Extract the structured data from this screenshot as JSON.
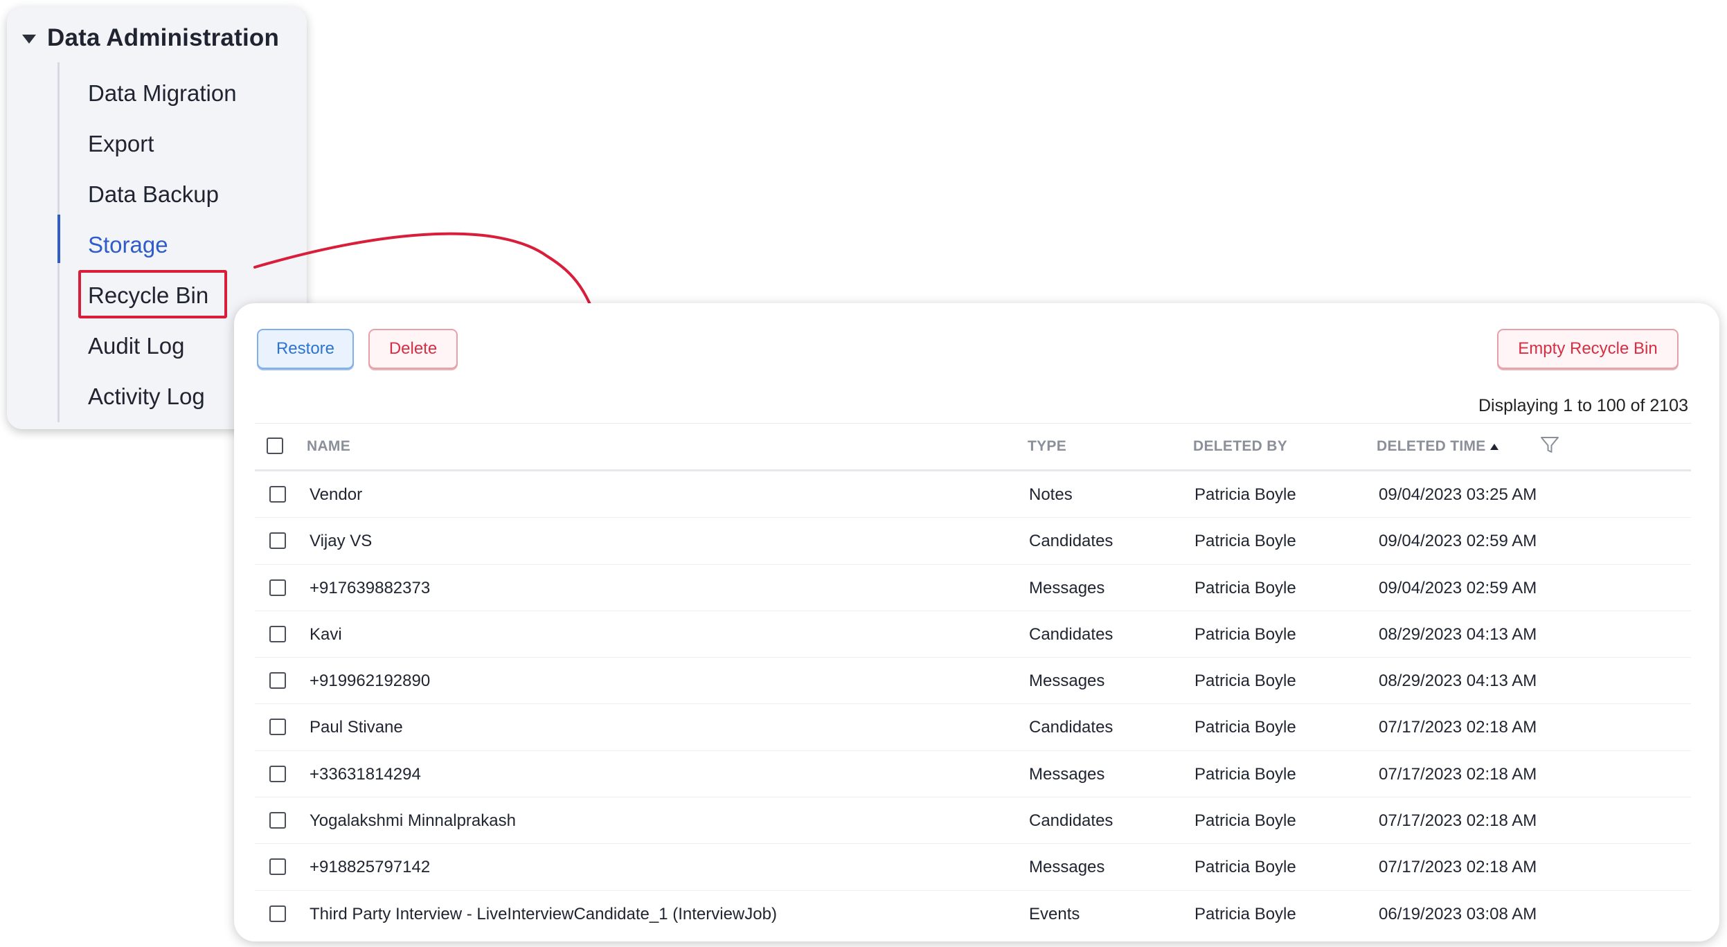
{
  "sidebar": {
    "section_title": "Data Administration",
    "items": [
      {
        "label": "Data Migration"
      },
      {
        "label": "Export"
      },
      {
        "label": "Data Backup"
      },
      {
        "label": "Storage"
      },
      {
        "label": "Recycle Bin"
      },
      {
        "label": "Audit Log"
      },
      {
        "label": "Activity Log"
      }
    ],
    "active_item": "Storage",
    "highlighted_item": "Recycle Bin"
  },
  "toolbar": {
    "restore_label": "Restore",
    "delete_label": "Delete",
    "empty_label": "Empty Recycle Bin"
  },
  "pagination": {
    "text": "Displaying 1 to 100 of 2103"
  },
  "table": {
    "columns": {
      "name": "NAME",
      "type": "TYPE",
      "deleted_by": "DELETED BY",
      "deleted_time": "DELETED TIME"
    },
    "sort_column": "DELETED TIME",
    "sort_direction": "ascending",
    "rows": [
      {
        "name": "Vendor",
        "type": "Notes",
        "deleted_by": "Patricia Boyle",
        "deleted_time": "09/04/2023 03:25 AM"
      },
      {
        "name": "Vijay VS",
        "type": "Candidates",
        "deleted_by": "Patricia Boyle",
        "deleted_time": "09/04/2023 02:59 AM"
      },
      {
        "name": "+917639882373",
        "type": "Messages",
        "deleted_by": "Patricia Boyle",
        "deleted_time": "09/04/2023 02:59 AM"
      },
      {
        "name": "Kavi",
        "type": "Candidates",
        "deleted_by": "Patricia Boyle",
        "deleted_time": "08/29/2023 04:13 AM"
      },
      {
        "name": "+919962192890",
        "type": "Messages",
        "deleted_by": "Patricia Boyle",
        "deleted_time": "08/29/2023 04:13 AM"
      },
      {
        "name": "Paul Stivane",
        "type": "Candidates",
        "deleted_by": "Patricia Boyle",
        "deleted_time": "07/17/2023 02:18 AM"
      },
      {
        "name": "+33631814294",
        "type": "Messages",
        "deleted_by": "Patricia Boyle",
        "deleted_time": "07/17/2023 02:18 AM"
      },
      {
        "name": "Yogalakshmi Minnalprakash",
        "type": "Candidates",
        "deleted_by": "Patricia Boyle",
        "deleted_time": "07/17/2023 02:18 AM"
      },
      {
        "name": "+918825797142",
        "type": "Messages",
        "deleted_by": "Patricia Boyle",
        "deleted_time": "07/17/2023 02:18 AM"
      },
      {
        "name": "Third Party Interview - LiveInterviewCandidate_1 (InterviewJob)",
        "type": "Events",
        "deleted_by": "Patricia Boyle",
        "deleted_time": "06/19/2023 03:08 AM"
      }
    ]
  },
  "icons": {
    "caret": "caret-down-icon",
    "filter": "filter-icon",
    "sort": "sort-ascending-icon",
    "arrow": "annotation-arrow"
  },
  "colors": {
    "accent_blue": "#2f5cc8",
    "highlight_red": "#d81e3a",
    "danger_text": "#d62e43",
    "restore_text": "#2c73d2"
  }
}
